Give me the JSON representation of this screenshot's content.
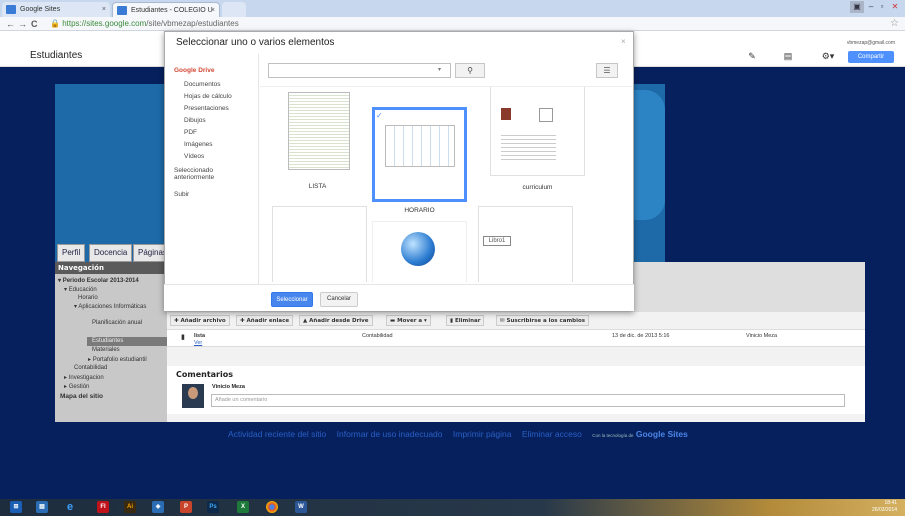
{
  "browser": {
    "tabs": [
      {
        "label": "Google Sites"
      },
      {
        "label": "Estudiantes - COLEGIO U"
      },
      {
        "label": ""
      }
    ],
    "url_secure": "https://sites.google.com",
    "url_path": "/site/vbmezap/estudiantes"
  },
  "site": {
    "title": "Estudiantes",
    "user_email": "vbmezap@gmail.com",
    "share_label": "Compartir",
    "nav_tabs": [
      "Perfil",
      "Docencia",
      "Páginas d"
    ],
    "nav_heading": "Navegación",
    "nav_items": [
      "Periodo Escolar 2013-2014",
      "Educación",
      "Horario",
      "Aplicaciones Informáticas",
      "Planificación anual",
      "Estudiantes",
      "Materiales",
      "Portafolio estudiantil",
      "Contabilidad",
      "Investigacion",
      "Gestión",
      "Mapa del sitio"
    ],
    "file_toolbar": [
      "Añadir archivo",
      "Añadir enlace",
      "Añadir desde Drive",
      "Mover a",
      "Eliminar",
      "Suscribirse a los cambios"
    ],
    "file_row": {
      "name": "lista",
      "action": "Ver",
      "folder": "Contabilidad",
      "date": "13 de dic. de 2013 5:16",
      "owner": "Vinicio Meza"
    },
    "comments": {
      "title": "Comentarios",
      "author": "Vinicio Meza",
      "placeholder": "Añade un comentario"
    },
    "footer": {
      "links": [
        "Actividad reciente del sitio",
        "Informar de uso inadecuado",
        "Imprimir página",
        "Eliminar acceso"
      ],
      "powered": "Con la tecnología de",
      "brand": "Google Sites"
    }
  },
  "picker": {
    "title": "Seleccionar uno o varios elementos",
    "close": "×",
    "categories": [
      "Google Drive",
      "Documentos",
      "Hojas de cálculo",
      "Presentaciones",
      "Dibujos",
      "PDF",
      "Imágenes",
      "Vídeos",
      "Seleccionado anteriormente",
      "Subir"
    ],
    "search_placeholder": "",
    "items": [
      {
        "label": "LISTA",
        "selected": false
      },
      {
        "label": "HORARIO",
        "selected": true
      },
      {
        "label": "curriculum",
        "selected": false
      },
      {
        "label": "",
        "selected": false
      },
      {
        "label": "",
        "selected": false
      },
      {
        "label": "Libro1",
        "selected": false
      }
    ],
    "select_label": "Seleccionar",
    "cancel_label": "Cancelar"
  },
  "taskbar": {
    "apps": [
      "start",
      "explorer",
      "ie",
      "flash",
      "illustrator",
      "dreamweaver",
      "powerpoint",
      "photoshop",
      "excel",
      "chrome",
      "word"
    ],
    "time": "18:41",
    "date": "26/03/2014"
  },
  "colors": {
    "accent": "#4d90fe",
    "drive_red": "#d14836",
    "site_bg": "#06205e"
  }
}
